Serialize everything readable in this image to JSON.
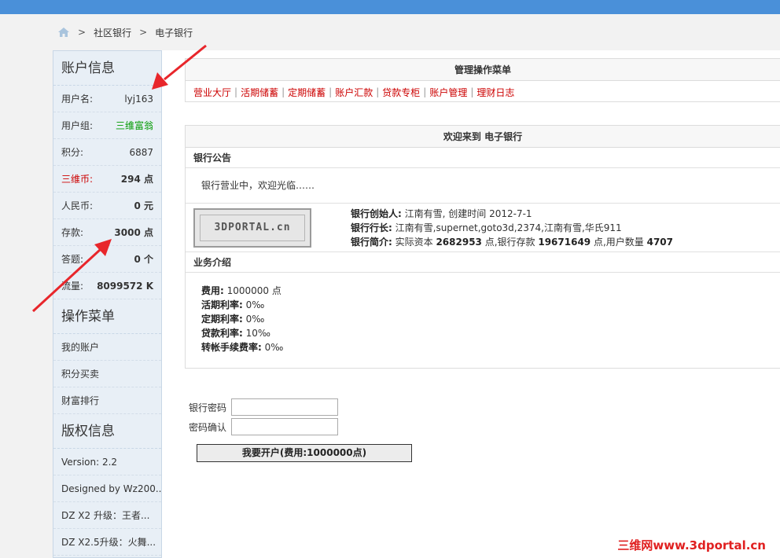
{
  "breadcrumb": {
    "items": [
      "社区银行",
      "电子银行"
    ],
    "separator": ">"
  },
  "sidebar": {
    "account_title": "账户信息",
    "account_rows": [
      {
        "label": "用户名:",
        "value": "lyj163"
      },
      {
        "label": "用户组:",
        "value": "三维富翁"
      },
      {
        "label": "积分:",
        "value": "6887"
      },
      {
        "label": "三维币:",
        "value": "294 点"
      },
      {
        "label": "人民币:",
        "value": "0 元"
      },
      {
        "label": "存款:",
        "value": "3000 点"
      },
      {
        "label": "答题:",
        "value": "0 个"
      },
      {
        "label": "流量:",
        "value": "8099572 K"
      }
    ],
    "menu_title": "操作菜单",
    "menu_items": [
      "我的账户",
      "积分买卖",
      "财富排行"
    ],
    "copyright_title": "版权信息",
    "copyright_items": [
      "Version: 2.2",
      "Designed by Wz200...",
      "DZ X2 升级：王者...",
      "DZ X2.5升级：火舞..."
    ]
  },
  "admin_menu": {
    "title": "管理操作菜单",
    "links": [
      "营业大厅",
      "活期储蓄",
      "定期储蓄",
      "账户汇款",
      "贷款专柜",
      "账户管理",
      "理财日志"
    ]
  },
  "welcome": {
    "title": "欢迎来到  电子银行",
    "notice_heading": "银行公告",
    "notice_text": "银行营业中，欢迎光临……",
    "logo_text": "3DPORTAL.cn",
    "founder_label": "银行创始人:",
    "founder_value": " 江南有雪, 创建时间  2012-7-1",
    "president_label": "银行行长:",
    "president_value": " 江南有雪,supernet,goto3d,2374,江南有雪,华氏911",
    "brief_label": "银行简介:",
    "brief_pre": " 实际资本  ",
    "capital": "2682953",
    "brief_mid": " 点,银行存款  ",
    "deposits": "19671649",
    "brief_mid2": " 点,用户数量  ",
    "users": "4707",
    "intro_heading": "业务介绍",
    "fee_label": "费用:",
    "fee_value": " 1000000 点",
    "current_rate_label": "活期利率:",
    "current_rate_value": " 0‰",
    "fixed_rate_label": "定期利率:",
    "fixed_rate_value": " 0‰",
    "loan_rate_label": "贷款利率:",
    "loan_rate_value": " 10‰",
    "transfer_rate_label": "转帐手续费率:",
    "transfer_rate_value": " 0‰"
  },
  "form": {
    "password_label": "银行密码",
    "confirm_label": "密码确认",
    "submit_label": "我要开户(费用:1000000点)"
  },
  "watermark": "三维网www.3dportal.cn",
  "colors": {
    "topbar": "#4a90d9",
    "sidebar_bg": "#e8eff6",
    "link_red": "#cc0000",
    "group_green": "#009900",
    "arrow_red": "#e8262b"
  }
}
